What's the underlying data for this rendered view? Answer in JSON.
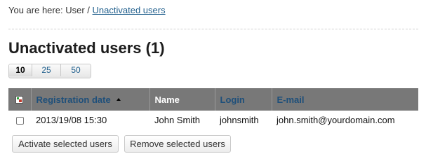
{
  "breadcrumb": {
    "prefix": "You are here:",
    "parent": "User",
    "separator": "/",
    "current": "Unactivated users"
  },
  "page_title": "Unactivated users (1)",
  "pager": {
    "options": [
      "10",
      "25",
      "50"
    ],
    "selected": "10"
  },
  "table": {
    "columns": {
      "select_all_icon": "grid-select-icon",
      "registration_date": "Registration date",
      "name": "Name",
      "login": "Login",
      "email": "E-mail"
    },
    "sorted_column": "registration_date",
    "sort_direction": "ascending",
    "rows": [
      {
        "checked": false,
        "registration_date": "2013/19/08 15:30",
        "name": "John Smith",
        "login": "johnsmith",
        "email": "john.smith@yourdomain.com"
      }
    ]
  },
  "actions": {
    "activate": "Activate selected users",
    "remove": "Remove selected users"
  },
  "colors": {
    "header_bg": "#787878",
    "link": "#1f5e8c",
    "sort_link": "#1e4f7a"
  }
}
